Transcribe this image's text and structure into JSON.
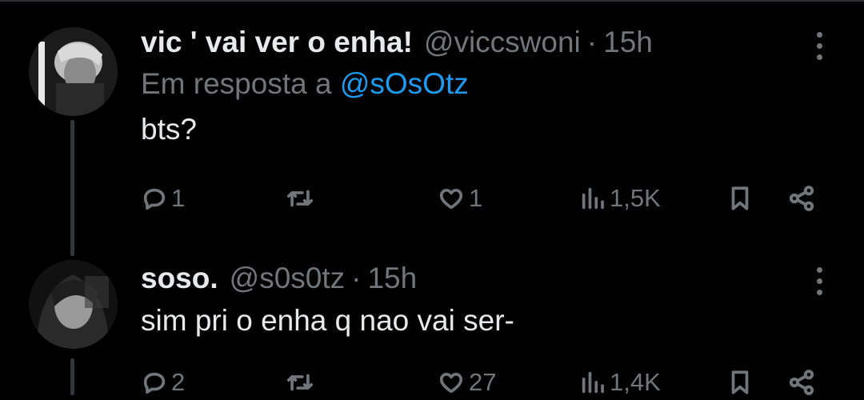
{
  "colors": {
    "background": "#000000",
    "text_primary": "#e7e9ea",
    "text_secondary": "#71767b",
    "link": "#1d9bf0",
    "divider": "#2f3336"
  },
  "tweets": [
    {
      "name": "vic ' vai ver o enha!",
      "handle": "@viccswoni",
      "separator": "·",
      "time": "15h",
      "reply_prefix": "Em resposta a",
      "reply_to": "@sOsOtz",
      "text": "bts?",
      "stats": {
        "replies": "1",
        "retweets": "",
        "likes": "1",
        "views": "1,5K"
      },
      "icons": [
        "reply-icon",
        "retweet-icon",
        "like-icon",
        "views-icon",
        "bookmark-icon",
        "share-icon"
      ]
    },
    {
      "name": "soso.",
      "handle": "@s0s0tz",
      "separator": "·",
      "time": "15h",
      "text": "sim pri o enha q nao vai ser-",
      "stats": {
        "replies": "2",
        "retweets": "",
        "likes": "27",
        "views": "1,4K"
      },
      "icons": [
        "reply-icon",
        "retweet-icon",
        "like-icon",
        "views-icon",
        "bookmark-icon",
        "share-icon"
      ]
    }
  ]
}
